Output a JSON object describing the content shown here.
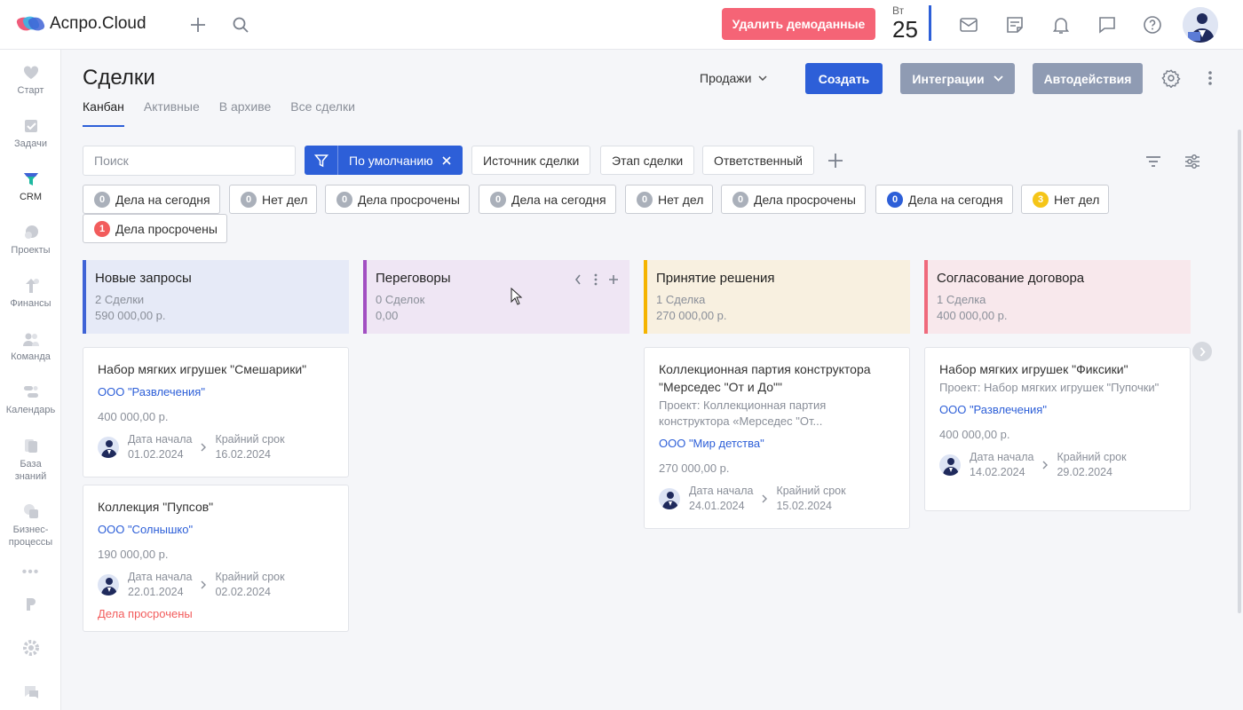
{
  "app": {
    "name": "Аспро.Cloud"
  },
  "header": {
    "demo_button": "Удалить демоданные",
    "date_weekday": "Вт",
    "date_day": "25"
  },
  "sidebar": {
    "items": [
      {
        "label": "Старт"
      },
      {
        "label": "Задачи"
      },
      {
        "label": "CRM"
      },
      {
        "label": "Проекты"
      },
      {
        "label": "Финансы"
      },
      {
        "label": "Команда"
      },
      {
        "label": "Календарь"
      },
      {
        "label": "База знаний"
      },
      {
        "label": "Бизнес-процессы"
      }
    ]
  },
  "page": {
    "title": "Сделки",
    "tabs": [
      "Канбан",
      "Активные",
      "В архиве",
      "Все сделки"
    ],
    "active_tab": 0,
    "pipeline_select": "Продажи",
    "create_button": "Создать",
    "integrations_button": "Интеграции",
    "autoactions_button": "Автодействия"
  },
  "filters": {
    "search_placeholder": "Поиск",
    "preset": "По умолчанию",
    "chips": [
      "Источник сделки",
      "Этап сделки",
      "Ответственный"
    ]
  },
  "activity_filters": [
    {
      "count": "0",
      "label": "Дела на сегодня",
      "color": "#aab0ba"
    },
    {
      "count": "0",
      "label": "Нет дел",
      "color": "#aab0ba"
    },
    {
      "count": "0",
      "label": "Дела просрочены",
      "color": "#aab0ba"
    },
    {
      "count": "0",
      "label": "Дела на сегодня",
      "color": "#aab0ba"
    },
    {
      "count": "0",
      "label": "Нет дел",
      "color": "#aab0ba"
    },
    {
      "count": "0",
      "label": "Дела просрочены",
      "color": "#aab0ba"
    },
    {
      "count": "0",
      "label": "Дела на сегодня",
      "color": "#2d5fd8"
    },
    {
      "count": "3",
      "label": "Нет дел",
      "color": "#f5c518"
    },
    {
      "count": "1",
      "label": "Дела просрочены",
      "color": "#f25c5c"
    }
  ],
  "columns": [
    {
      "title": "Новые запросы",
      "count": "2 Сделки",
      "sum": "590 000,00 р.",
      "color": "#3f63d6",
      "bg": "#e6eaf7"
    },
    {
      "title": "Переговоры",
      "count": "0 Сделок",
      "sum": "0,00",
      "color": "#a24fc2",
      "bg": "#efe6f4"
    },
    {
      "title": "Принятие решения",
      "count": "1 Сделка",
      "sum": "270 000,00 р.",
      "color": "#f5b400",
      "bg": "#f8f0e0"
    },
    {
      "title": "Согласование договора",
      "count": "1 Сделка",
      "sum": "400 000,00 р.",
      "color": "#ef6a7c",
      "bg": "#f8e8ec"
    }
  ],
  "dates_labels": {
    "start": "Дата начала",
    "deadline": "Крайний срок"
  },
  "cards": [
    {
      "title": "Набор мягких игрушек \"Смешарики\"",
      "company": "ООО \"Развлечения\"",
      "sum": "400 000,00 р.",
      "start": "01.02.2024",
      "deadline": "16.02.2024"
    },
    {
      "title": "Коллекция \"Пупсов\"",
      "company": "ООО \"Солнышко\"",
      "sum": "190 000,00 р.",
      "start": "22.01.2024",
      "deadline": "02.02.2024",
      "overdue": "Дела просрочены"
    },
    {
      "title": "Коллекционная партия конструктора \"Мерседес \"От и До\"\"",
      "project": "Проект: Коллекционная партия конструктора «Мерседес \"От...",
      "company": "ООО \"Мир детства\"",
      "sum": "270 000,00 р.",
      "start": "24.01.2024",
      "deadline": "15.02.2024"
    },
    {
      "title": "Набор мягких игрушек \"Фиксики\"",
      "project": "Проект: Набор мягких игрушек \"Пупочки\"",
      "company": "ООО \"Развлечения\"",
      "sum": "400 000,00 р.",
      "start": "14.02.2024",
      "deadline": "29.02.2024"
    }
  ],
  "colors": {
    "accent": "#2d5fd8",
    "demo": "#f56476",
    "gray_button": "#8f9bb3"
  }
}
